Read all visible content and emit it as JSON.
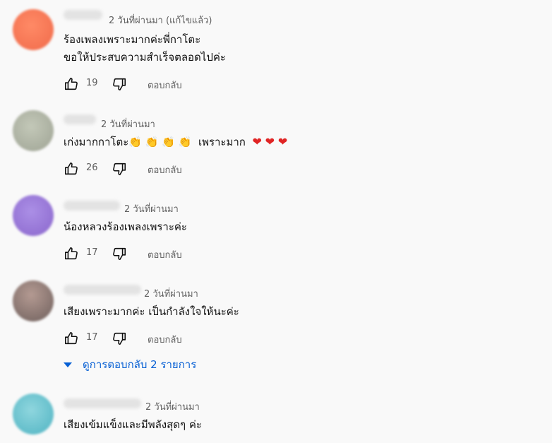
{
  "comments": [
    {
      "time": "2 วันที่ผ่านมา",
      "edited": "(แก้ไขแล้ว)",
      "lines": "ร้องเพลงเพราะมากค่ะพี่กาโตะ\nขอให้ประสบความสำเร็จตลอดไปค่ะ",
      "likes": "19",
      "reply": "ตอบกลับ",
      "avatar_color": "#f47a5a"
    },
    {
      "time": "2 วันที่ผ่านมา",
      "text_before": "เก่งมากกาโตะ",
      "clap": "👏",
      "text_mid": "เพราะมาก",
      "heart": "❤",
      "likes": "26",
      "reply": "ตอบกลับ",
      "avatar_color": "#aeb3a5"
    },
    {
      "time": "2 วันที่ผ่านมา",
      "lines": "น้องหลวงร้องเพลงเพราะค่ะ",
      "likes": "17",
      "reply": "ตอบกลับ",
      "avatar_color": "#9a7ad8"
    },
    {
      "time": "2 วันที่ผ่านมา",
      "lines": "เสียงเพราะมากค่ะ เป็นกำลังใจให้นะค่ะ",
      "likes": "17",
      "reply": "ตอบกลับ",
      "avatar_color": "#8e7a74"
    },
    {
      "time": "2 วันที่ผ่านมา",
      "lines": "เสียงเข้มแข็งและมีพลังสุดๆ ค่ะ",
      "avatar_color": "#6cc2cf"
    }
  ],
  "replies_toggle": "ดูการตอบกลับ 2 รายการ",
  "icons": {
    "like": "thumbs-up-icon",
    "dislike": "thumbs-down-icon",
    "toggle": "caret-down-icon"
  },
  "colors": {
    "link": "#065fd4",
    "heart": "#e02424"
  }
}
